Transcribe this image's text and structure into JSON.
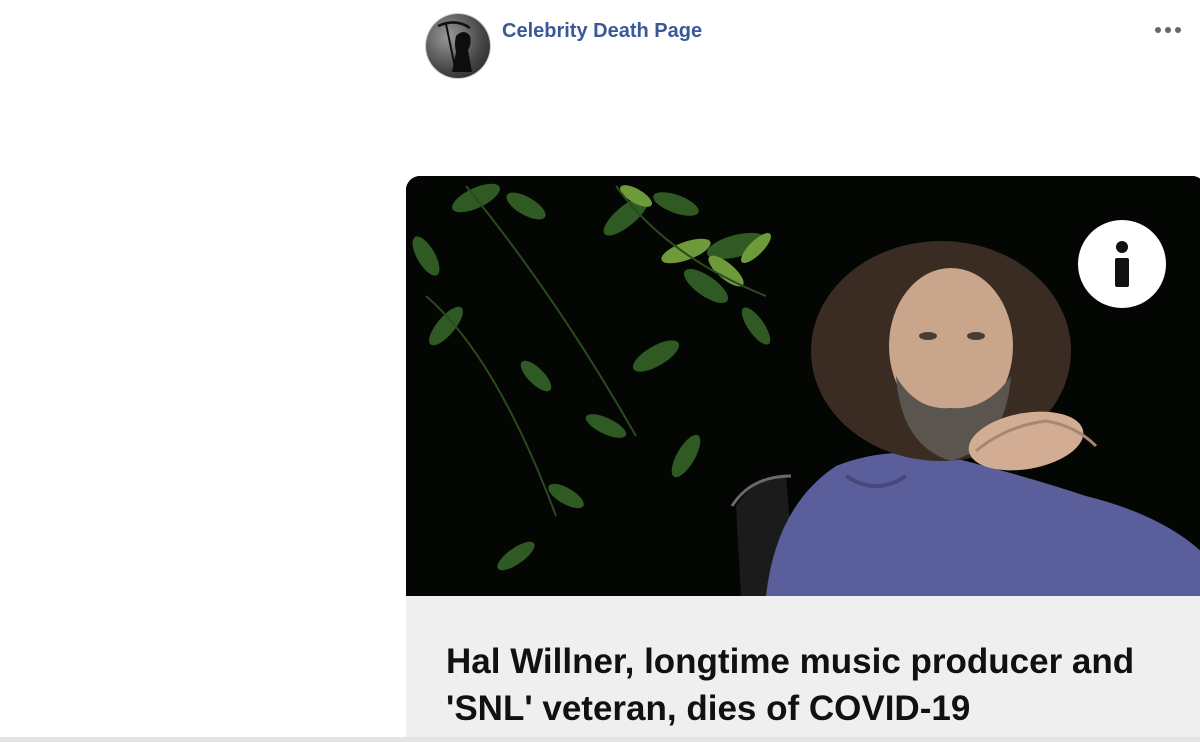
{
  "post": {
    "page_name": "Celebrity Death Page",
    "avatar_icon": "grim-reaper-avatar-icon",
    "more_icon": "ellipsis-icon"
  },
  "link_card": {
    "headline": "Hal Willner, longtime music producer and 'SNL' veteran, dies of COVID-19",
    "info_icon": "info-icon"
  },
  "colors": {
    "page_name": "#3b5998",
    "card_background": "#efefef",
    "headline_text": "#111111"
  }
}
